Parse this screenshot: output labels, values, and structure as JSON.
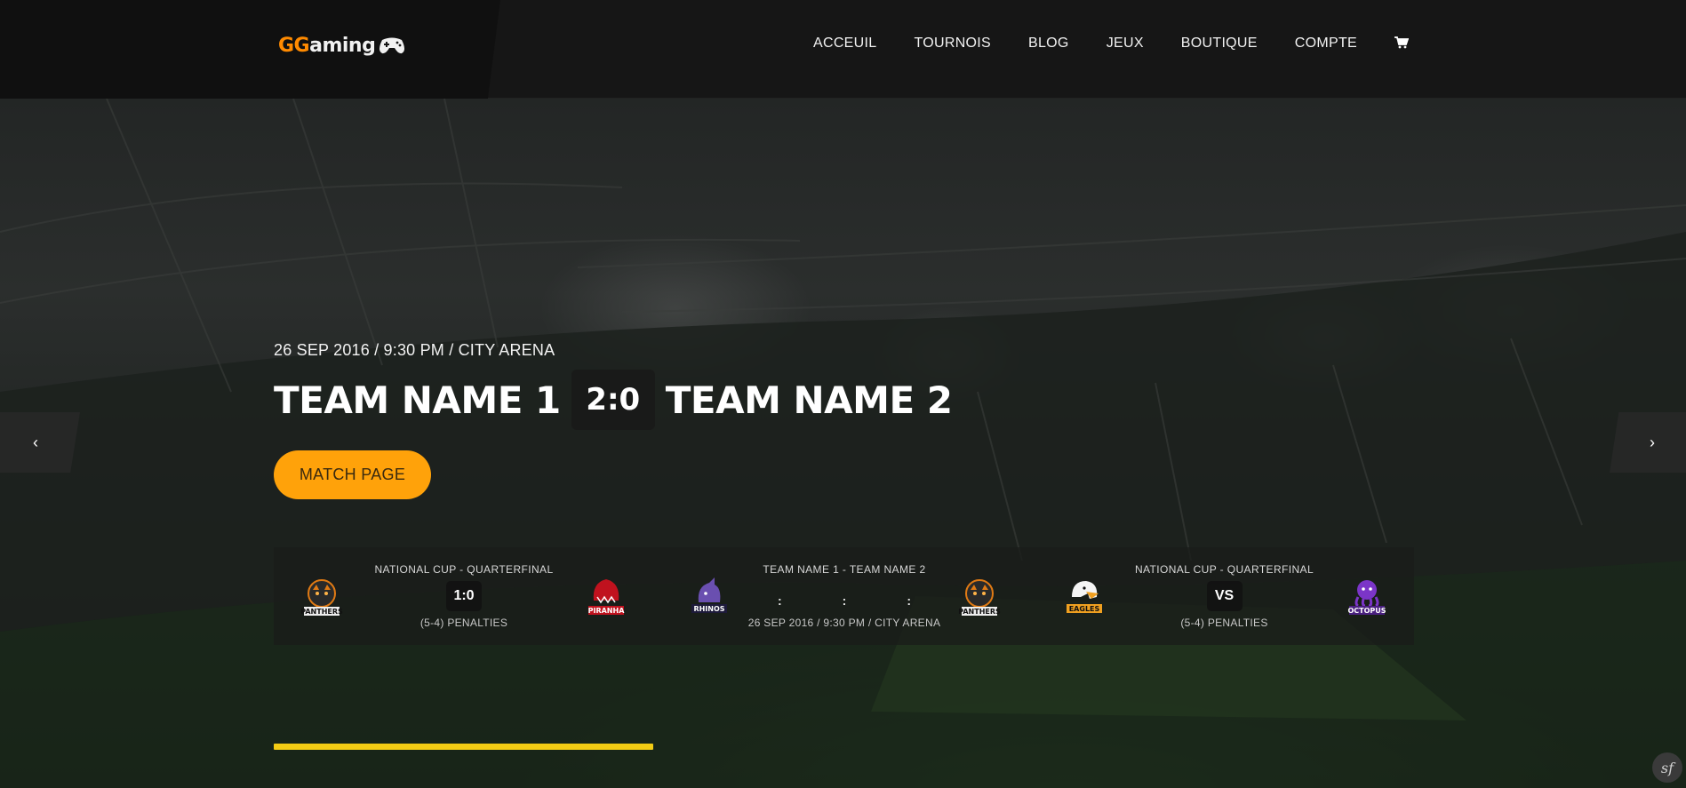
{
  "brand": {
    "logo_gg": "GG",
    "logo_rest": "aming"
  },
  "nav": {
    "items": [
      "ACCEUIL",
      "TOURNOIS",
      "BLOG",
      "JEUX",
      "BOUTIQUE",
      "COMPTE"
    ],
    "cart_icon": "shopping-cart-icon"
  },
  "hero": {
    "match_info": "26 SEP 2016 / 9:30 PM / CITY ARENA",
    "team1": "TEAM NAME 1",
    "score": "2:0",
    "team2": "TEAM NAME 2",
    "button_label": "MATCH PAGE",
    "prev_arrow": "‹",
    "next_arrow": "›"
  },
  "ticker": {
    "fixtures": [
      {
        "title": "NATIONAL CUP - QUARTERFINAL",
        "center": "1:0",
        "sub": "(5-4) PENALTIES",
        "home": "PANTHERS",
        "away": "PIRANHA"
      },
      {
        "title": "TEAM NAME 1 - TEAM NAME 2",
        "center": "",
        "countdown": [
          ":",
          ":",
          ":"
        ],
        "sub": "26 SEP 2016 / 9:30 PM / CITY ARENA",
        "home": "RHINOS",
        "away": "PANTHERS"
      },
      {
        "title": "NATIONAL CUP - QUARTERFINAL",
        "center": "VS",
        "sub": "(5-4) PENALTIES",
        "home": "EAGLES",
        "away": "OCTOPUS"
      }
    ],
    "progress_fraction": 0.333
  },
  "colors": {
    "accent": "#ffa20a",
    "logo_orange": "#ff8a00",
    "progress": "#f3cc14"
  },
  "corner_badge": "sf"
}
